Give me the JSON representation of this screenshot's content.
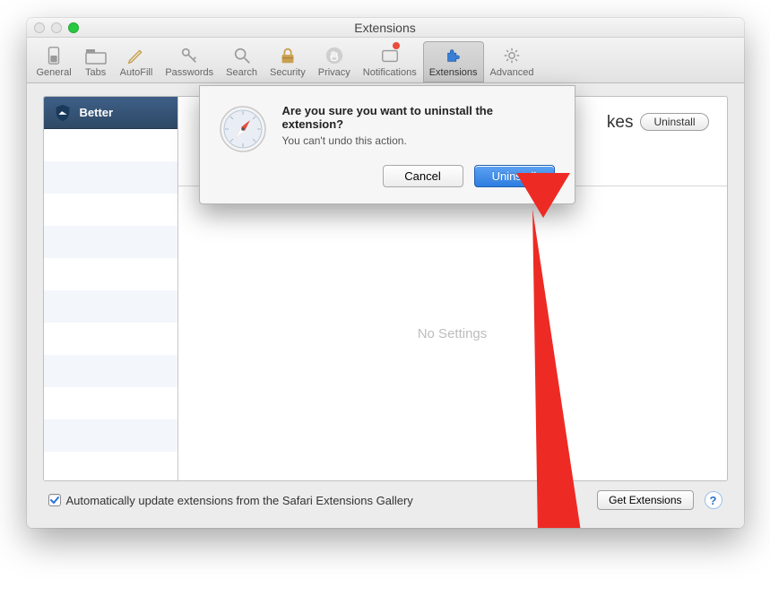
{
  "window": {
    "title": "Extensions"
  },
  "toolbar": {
    "items": [
      {
        "label": "General"
      },
      {
        "label": "Tabs"
      },
      {
        "label": "AutoFill"
      },
      {
        "label": "Passwords"
      },
      {
        "label": "Search"
      },
      {
        "label": "Security"
      },
      {
        "label": "Privacy"
      },
      {
        "label": "Notifications"
      },
      {
        "label": "Extensions"
      },
      {
        "label": "Advanced"
      }
    ]
  },
  "sidebar": {
    "items": [
      {
        "label": "Better"
      }
    ]
  },
  "detail": {
    "header_fragment": "kes",
    "uninstall_label": "Uninstall",
    "no_settings": "No Settings"
  },
  "dialog": {
    "title": "Are you sure you want to uninstall the extension?",
    "message": "You can't undo this action.",
    "cancel": "Cancel",
    "confirm": "Uninstall"
  },
  "footer": {
    "auto_update_label": "Automatically update extensions from the Safari Extensions Gallery",
    "auto_update_checked": true,
    "get_extensions": "Get Extensions"
  }
}
